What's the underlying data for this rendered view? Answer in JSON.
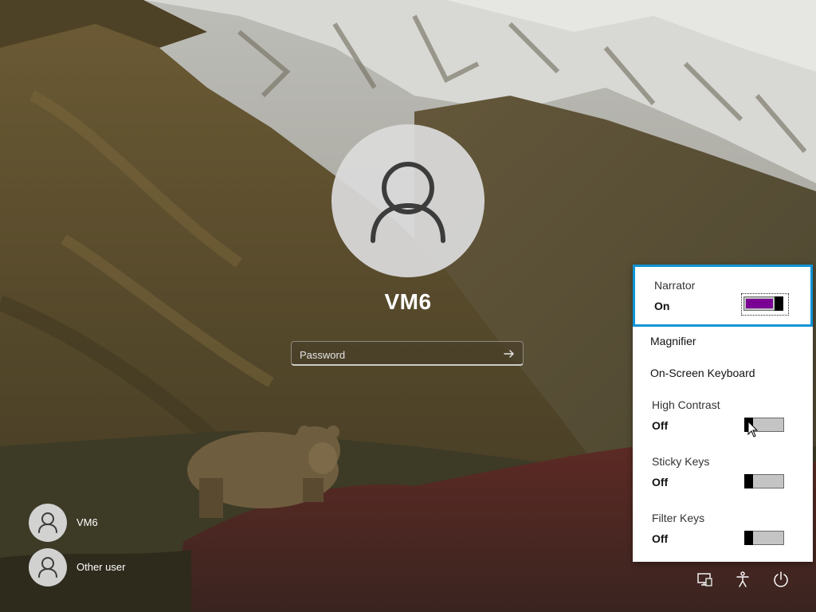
{
  "login": {
    "username": "VM6",
    "password_placeholder": "Password"
  },
  "users": [
    {
      "name": "VM6"
    },
    {
      "name": "Other user"
    }
  ],
  "accessibility_menu": {
    "narrator": {
      "label": "Narrator",
      "state": "On"
    },
    "magnifier": {
      "label": "Magnifier"
    },
    "on_screen_keyboard": {
      "label": "On-Screen Keyboard"
    },
    "high_contrast": {
      "label": "High Contrast",
      "state": "Off"
    },
    "sticky_keys": {
      "label": "Sticky Keys",
      "state": "Off"
    },
    "filter_keys": {
      "label": "Filter Keys",
      "state": "Off"
    }
  },
  "system_buttons": {
    "network": "network-icon",
    "accessibility": "accessibility-icon",
    "power": "power-icon"
  },
  "colors": {
    "focus_border": "#0f94d6",
    "toggle_on_fill": "#7a0093",
    "flyout_bg": "#ffffff"
  }
}
